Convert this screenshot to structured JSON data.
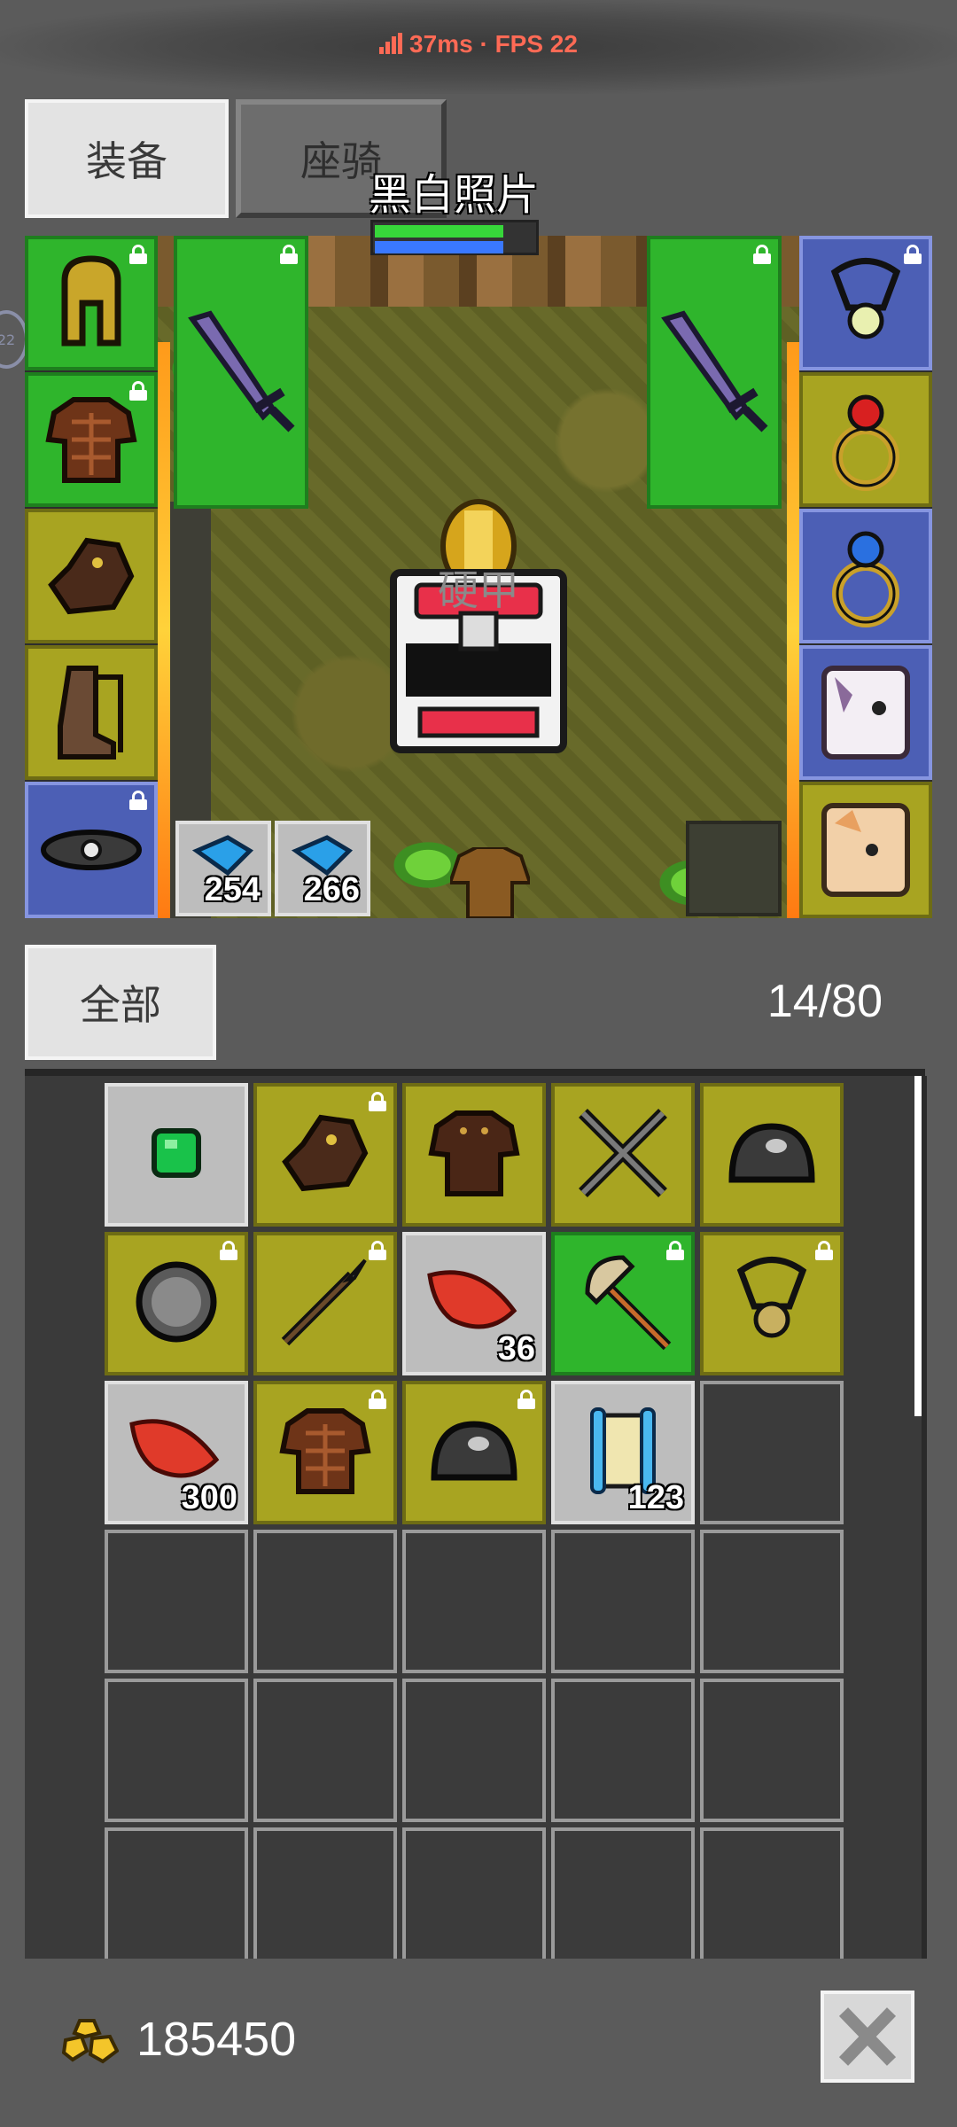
{
  "status": {
    "ping": "37ms",
    "separator": "·",
    "fps": "FPS 22"
  },
  "tabs": [
    {
      "label": "装备",
      "active": true
    },
    {
      "label": "座骑",
      "active": false
    }
  ],
  "side_bubble": "22",
  "character": {
    "name": "黑白照片",
    "hp": 0.79,
    "mp": 0.79
  },
  "equipment": {
    "armor_label": "硬甲",
    "left_slots": [
      "helmet-icon",
      "chest-armor-icon",
      "gloves-icon",
      "boots-icon",
      "belt-icon"
    ],
    "weapon_slots": [
      "sword-icon",
      "sword-icon"
    ],
    "right_slots": [
      "necklace-icon",
      "ruby-ring-icon",
      "sapphire-ring-icon",
      "unicorn-pet-icon",
      "fox-pet-icon"
    ]
  },
  "quick_items": [
    {
      "icon": "blue-potion-icon",
      "count": "254"
    },
    {
      "icon": "blue-potion-icon",
      "count": "266"
    }
  ],
  "inventory": {
    "filter_label": "全部",
    "capacity": "14/80",
    "rows": [
      [
        {
          "icon": "emerald-gem-icon",
          "color": "gray"
        },
        {
          "icon": "gloves-icon",
          "color": "olive",
          "locked": true
        },
        {
          "icon": "leather-armor-icon",
          "color": "olive"
        },
        {
          "icon": "crossed-swords-icon",
          "color": "olive"
        },
        {
          "icon": "iron-helmet-icon",
          "color": "olive"
        }
      ],
      [
        {
          "icon": "round-shield-icon",
          "color": "olive",
          "locked": true
        },
        {
          "icon": "spear-icon",
          "color": "olive",
          "locked": true
        },
        {
          "icon": "red-feather-icon",
          "color": "gray",
          "count": "36"
        },
        {
          "icon": "battle-axe-icon",
          "color": "green",
          "locked": true
        },
        {
          "icon": "amulet-icon",
          "color": "olive",
          "locked": true
        }
      ],
      [
        {
          "icon": "red-feather-icon",
          "color": "gray",
          "count": "300"
        },
        {
          "icon": "chest-armor-icon",
          "color": "olive",
          "locked": true
        },
        {
          "icon": "iron-helmet-icon",
          "color": "olive",
          "locked": true
        },
        {
          "icon": "scroll-icon",
          "color": "gray",
          "count": "123"
        },
        {
          "color": "empty"
        }
      ]
    ]
  },
  "gold": {
    "amount": "185450",
    "icon": "gold-coins-icon"
  },
  "close_icon": "close-icon"
}
